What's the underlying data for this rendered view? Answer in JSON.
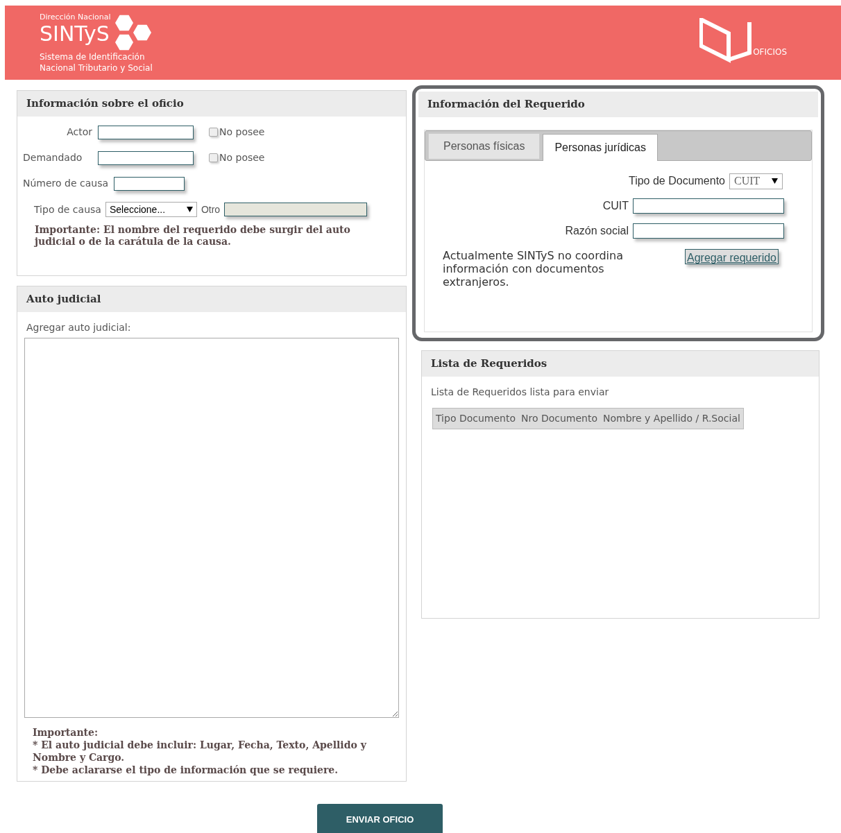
{
  "header": {
    "logo_top": "Dirección Nacional",
    "logo_name": "SINTyS",
    "logo_sub": [
      "Sistema de Identificación",
      "Nacional Tributario y Social"
    ],
    "app_label": "OFICIOS"
  },
  "oficio_panel": {
    "title": "Información sobre el oficio",
    "fields": [
      {
        "kind": "text_check",
        "label": "Actor",
        "checkbox": {
          "label": "No posee",
          "checked": false
        }
      },
      {
        "kind": "text_check",
        "label": "Demandado",
        "checkbox": {
          "label": "No posee",
          "checked": false
        }
      },
      {
        "kind": "text",
        "label": "Número de causa"
      },
      {
        "kind": "select_other",
        "label": "Tipo de causa",
        "value": "Seleccione...",
        "other": {
          "label": "Otro",
          "disabled": true
        }
      }
    ],
    "note": "Importante: El nombre del requerido debe surgir del auto judicial o de la carátula de la causa."
  },
  "auto_panel": {
    "title": "Auto judicial",
    "label": "Agregar auto judicial:",
    "notes": [
      "Importante:",
      "* El auto judicial debe incluir: Lugar, Fecha, Texto, Apellido y Nombre y Cargo.",
      "* Debe aclararse el tipo de información que se requiere."
    ]
  },
  "requerido_panel": {
    "title": "Información del Requerido",
    "highlighted": true,
    "tabs": [
      {
        "label": "Personas físicas",
        "selected": false
      },
      {
        "label": "Personas jurídicas",
        "selected": true
      }
    ],
    "fields": [
      {
        "kind": "select",
        "label": "Tipo de Documento",
        "value": "CUIT"
      },
      {
        "kind": "text",
        "label": "CUIT"
      },
      {
        "kind": "text",
        "label": "Razón social"
      }
    ],
    "note": "Actualmente SINTyS no coordina información con documentos extranjeros.",
    "button": "Agregar requerido"
  },
  "lista_panel": {
    "title": "Lista de Requeridos",
    "caption": "Lista de Requeridos lista para enviar",
    "columns": [
      "Tipo Documento",
      "Nro Documento",
      "Nombre y Apellido / R.Social"
    ]
  },
  "submit": "ENVIAR OFICIO"
}
